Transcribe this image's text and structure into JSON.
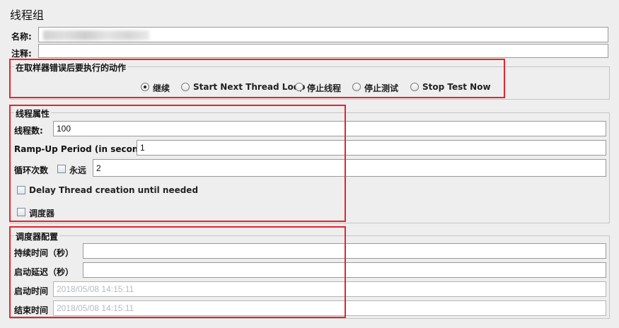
{
  "panel_title": "线程组",
  "name": {
    "label": "名称:",
    "value": ""
  },
  "comment": {
    "label": "注释:",
    "value": ""
  },
  "sampler_error": {
    "title": "在取样器错误后要执行的动作",
    "options": [
      "继续",
      "Start Next Thread Loop",
      "停止线程",
      "停止测试",
      "Stop Test Now"
    ],
    "selected": "继续"
  },
  "thread_props": {
    "title": "线程属性",
    "threads_label": "线程数:",
    "threads_value": "100",
    "rampup_label": "Ramp-Up Period (in seconds):",
    "rampup_value": "1",
    "loop_label": "循环次数",
    "forever_label": "永远",
    "forever_checked": false,
    "loop_value": "2",
    "delay_label": "Delay Thread creation until needed",
    "delay_checked": false,
    "scheduler_label": "调度器",
    "scheduler_checked": false
  },
  "scheduler_config": {
    "title": "调度器配置",
    "duration_label": "持续时间（秒）",
    "duration_value": "",
    "startup_delay_label": "启动延迟（秒）",
    "startup_delay_value": "",
    "start_time_label": "启动时间",
    "start_time_value": "2018/05/08 14:15:11",
    "end_time_label": "结束时间",
    "end_time_value": "2018/05/08 14:15:11"
  },
  "colors": {
    "highlight": "#e6242b",
    "background": "#eeeeee",
    "disabled_text": "#b4b9c4"
  }
}
